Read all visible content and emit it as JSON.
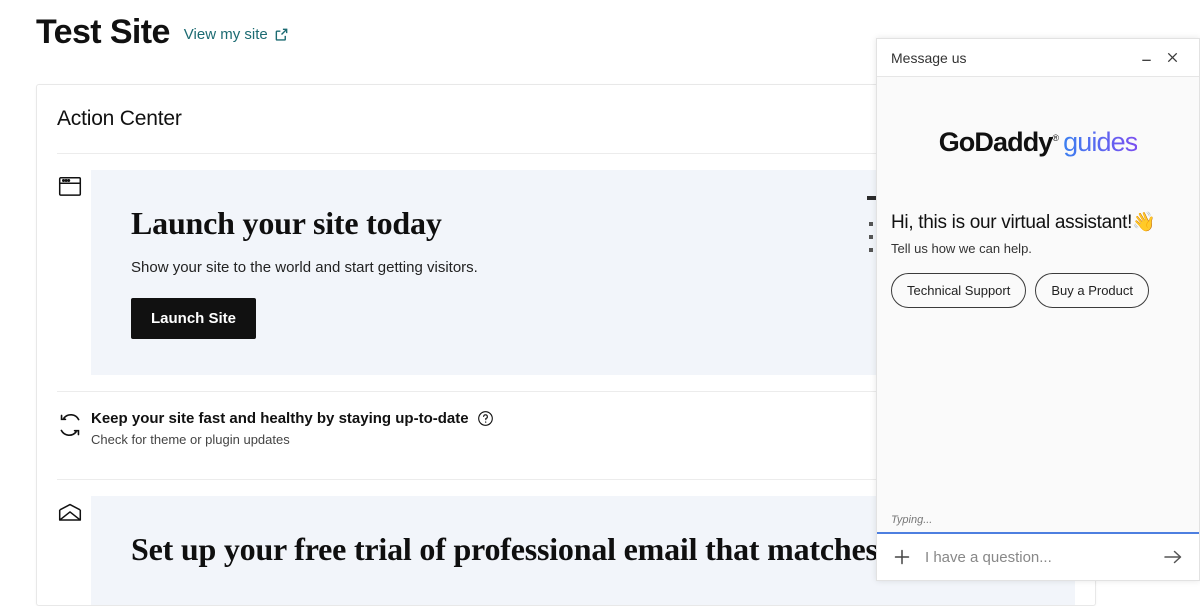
{
  "header": {
    "site_title": "Test Site",
    "view_link_label": "View my site",
    "view_link_icon": "external-link-icon"
  },
  "action_center": {
    "title": "Action Center",
    "rows": [
      {
        "icon": "browser-window-icon",
        "type": "promo",
        "heading": "Launch your site today",
        "subtext": "Show your site to the world and start getting visitors.",
        "button_label": "Launch Site"
      },
      {
        "icon": "refresh-sync-icon",
        "type": "plain",
        "heading": "Keep your site fast and healthy by staying up-to-date",
        "subtext": "Check for theme or plugin updates",
        "help_icon": "question-mark-circle-icon"
      },
      {
        "icon": "envelope-icon",
        "type": "promo",
        "heading": "Set up your free trial of professional email that matches"
      }
    ]
  },
  "chat": {
    "header_title": "Message us",
    "minimize_icon": "minimize-icon",
    "close_icon": "close-icon",
    "brand_primary": "GoDaddy",
    "brand_registered": "®",
    "brand_secondary": "guides",
    "greeting": "Hi, this is our virtual assistant!👋",
    "greeting_sub": "Tell us how we can help.",
    "quick_replies": [
      "Technical Support",
      "Buy a Product"
    ],
    "typing_status": "Typing...",
    "input_placeholder": "I have a question...",
    "input_value": "",
    "add_icon": "plus-icon",
    "send_icon": "arrow-right-icon"
  },
  "colors": {
    "link_teal": "#1c6b72",
    "promo_bg": "#f2f5fa",
    "button_dark": "#111111",
    "chat_accent": "#4d7fe0",
    "guides_gradient_start": "#3b7ff0",
    "guides_gradient_end": "#7a4ff0"
  }
}
